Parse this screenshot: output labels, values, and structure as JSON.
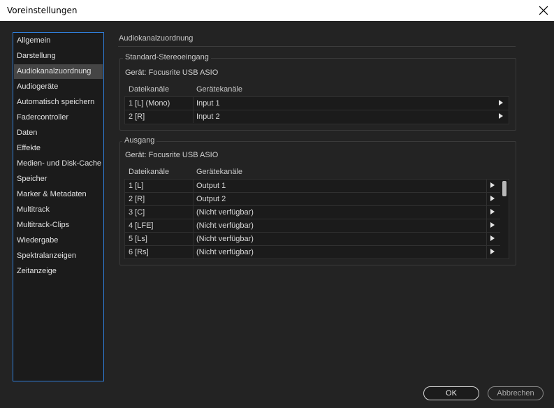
{
  "window": {
    "title": "Voreinstellungen"
  },
  "sidebar": {
    "items": [
      {
        "label": "Allgemein"
      },
      {
        "label": "Darstellung"
      },
      {
        "label": "Audiokanalzuordnung",
        "selected": true
      },
      {
        "label": "Audiogeräte"
      },
      {
        "label": "Automatisch speichern"
      },
      {
        "label": "Fadercontroller"
      },
      {
        "label": "Daten"
      },
      {
        "label": "Effekte"
      },
      {
        "label": "Medien- und Disk-Cache"
      },
      {
        "label": "Speicher"
      },
      {
        "label": "Marker & Metadaten"
      },
      {
        "label": "Multitrack"
      },
      {
        "label": "Multitrack-Clips"
      },
      {
        "label": "Wiedergabe"
      },
      {
        "label": "Spektralanzeigen"
      },
      {
        "label": "Zeitanzeige"
      }
    ]
  },
  "main": {
    "header": "Audiokanalzuordnung",
    "input_group": {
      "legend": "Standard-Stereoeingang",
      "device": "Gerät: Focusrite USB ASIO",
      "col_file": "Dateikanäle",
      "col_device": "Gerätekanäle",
      "rows": [
        {
          "file": "1 [L] (Mono)",
          "device": "Input 1"
        },
        {
          "file": "2 [R]",
          "device": "Input 2"
        }
      ]
    },
    "output_group": {
      "legend": "Ausgang",
      "device": "Gerät: Focusrite USB ASIO",
      "col_file": "Dateikanäle",
      "col_device": "Gerätekanäle",
      "rows": [
        {
          "file": "1 [L]",
          "device": "Output 1"
        },
        {
          "file": "2 [R]",
          "device": "Output 2"
        },
        {
          "file": "3 [C]",
          "device": "(Nicht verfügbar)"
        },
        {
          "file": "4 [LFE]",
          "device": "(Nicht verfügbar)"
        },
        {
          "file": "5 [Ls]",
          "device": "(Nicht verfügbar)"
        },
        {
          "file": "6 [Rs]",
          "device": "(Nicht verfügbar)"
        }
      ]
    }
  },
  "buttons": {
    "ok": "OK",
    "cancel": "Abbrechen"
  },
  "icons": {
    "close": "close-icon",
    "row_arrow": "triangle-right-icon"
  },
  "colors": {
    "accent": "#2f7dd8",
    "background": "#232323",
    "selected": "#454545"
  }
}
